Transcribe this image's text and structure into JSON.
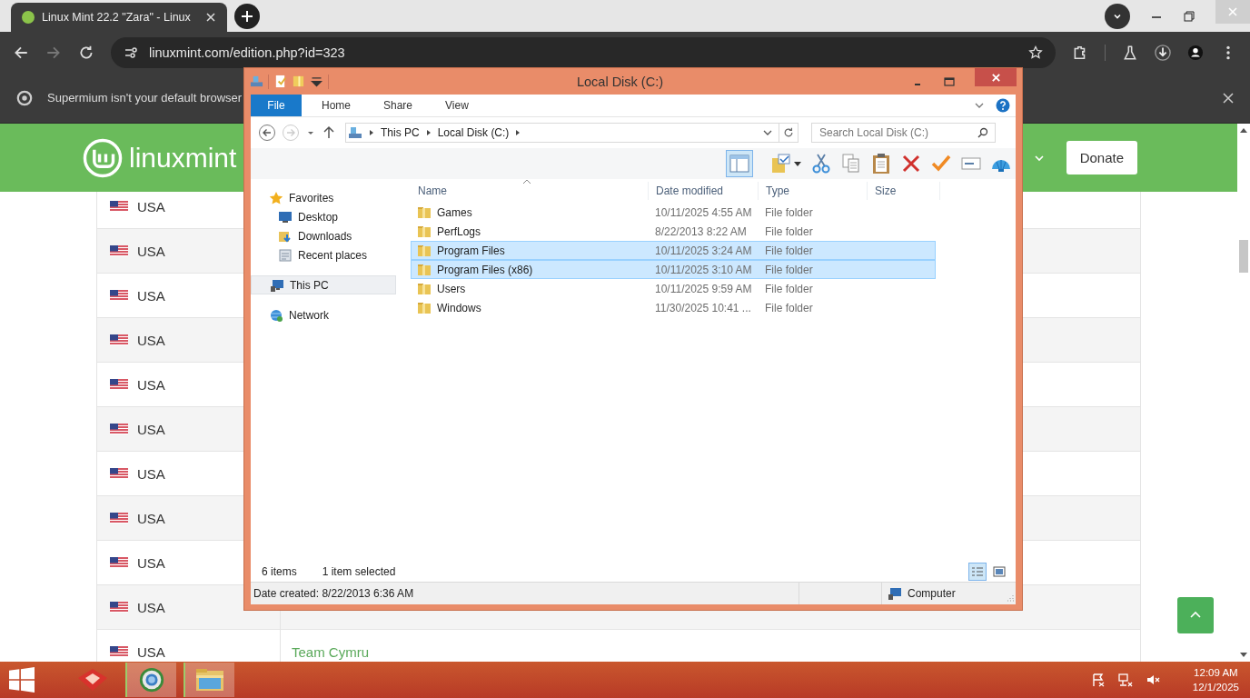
{
  "browser": {
    "tab_title": "Linux Mint 22.2 \"Zara\" - Linux",
    "url": "linuxmint.com/edition.php?id=323",
    "infobar": "Supermium isn't your default browser"
  },
  "site": {
    "logo_text": "linuxmint",
    "donate": "Donate",
    "rows": [
      {
        "country": "USA"
      },
      {
        "country": "USA"
      },
      {
        "country": "USA"
      },
      {
        "country": "USA"
      },
      {
        "country": "USA"
      },
      {
        "country": "USA"
      },
      {
        "country": "USA"
      },
      {
        "country": "USA"
      },
      {
        "country": "USA"
      },
      {
        "country": "USA"
      },
      {
        "country": "USA",
        "mirror": "Team Cymru"
      }
    ]
  },
  "explorer": {
    "title": "Local Disk (C:)",
    "ribbon_tabs": [
      {
        "label": "File",
        "selected": true
      },
      {
        "label": "Home",
        "selected": false
      },
      {
        "label": "Share",
        "selected": false
      },
      {
        "label": "View",
        "selected": false
      }
    ],
    "forward_disabled": true,
    "path": [
      "This PC",
      "Local Disk (C:)"
    ],
    "search": {
      "placeholder": "Search Local Disk (C:)"
    },
    "nav": [
      {
        "label": "Favorites",
        "selected": false,
        "children": [
          {
            "label": "Desktop",
            "selected": false
          },
          {
            "label": "Downloads",
            "selected": false
          },
          {
            "label": "Recent places",
            "selected": false
          }
        ]
      },
      {
        "label": "This PC",
        "selected": true
      },
      {
        "label": "Network",
        "selected": false
      }
    ],
    "columns": [
      "Name",
      "Date modified",
      "Type",
      "Size"
    ],
    "files": [
      {
        "name": "Games",
        "date": "10/11/2025 4:55 AM",
        "type": "File folder",
        "selected": false
      },
      {
        "name": "PerfLogs",
        "date": "8/22/2013 8:22 AM",
        "type": "File folder",
        "selected": false
      },
      {
        "name": "Program Files",
        "date": "10/11/2025 3:24 AM",
        "type": "File folder",
        "selected": true
      },
      {
        "name": "Program Files (x86)",
        "date": "10/11/2025 3:10 AM",
        "type": "File folder",
        "selected": true
      },
      {
        "name": "Users",
        "date": "10/11/2025 9:59 AM",
        "type": "File folder",
        "selected": false
      },
      {
        "name": "Windows",
        "date": "11/30/2025 10:41 ...",
        "type": "File folder",
        "selected": false
      }
    ],
    "item_count": "6 items",
    "selection": "1 item selected",
    "views": [
      {
        "kind": "details",
        "selected": true
      },
      {
        "kind": "thumbnails",
        "selected": false
      }
    ],
    "date_created": "Date created: 8/22/2013 6:36 AM",
    "location": "Computer"
  },
  "taskbar": {
    "apps": [
      {
        "kind": "red",
        "active": false
      },
      {
        "kind": "browser",
        "active": true
      },
      {
        "kind": "folder",
        "active": true
      }
    ],
    "time": "12:09 AM",
    "date": "12/1/2025"
  }
}
